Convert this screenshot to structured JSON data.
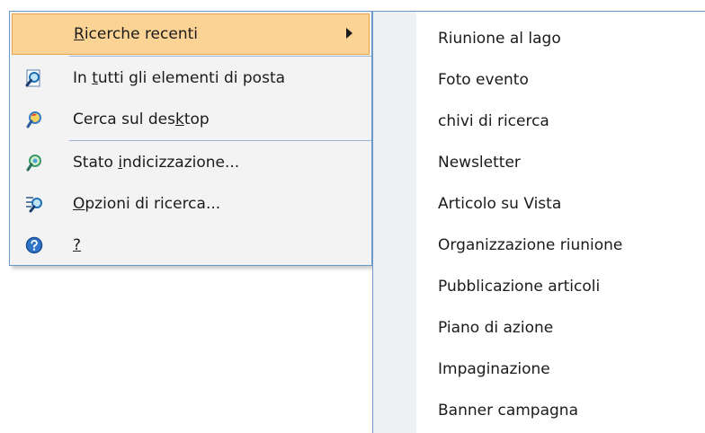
{
  "menu": {
    "items": [
      {
        "before": "",
        "key": "R",
        "after": "icerche recenti",
        "icon": "none",
        "highlighted": true,
        "has_submenu": true
      },
      {
        "before": "In ",
        "key": "t",
        "after": "utti gli elementi di posta",
        "icon": "search-document-icon"
      },
      {
        "before": "Cerca sul des",
        "key": "k",
        "after": "top",
        "icon": "search-desktop-icon"
      },
      {
        "before": "Stato ",
        "key": "i",
        "after": "ndicizzazione...",
        "icon": "indexing-status-icon"
      },
      {
        "before": "",
        "key": "O",
        "after": "pzioni di ricerca...",
        "icon": "search-options-icon"
      },
      {
        "before": "",
        "key": "?",
        "after": "",
        "icon": "help-icon"
      }
    ]
  },
  "submenu": {
    "items": [
      "Riunione al lago",
      "Foto evento",
      "chivi di ricerca",
      "Newsletter",
      "Articolo su Vista",
      "Organizzazione riunione",
      "Pubblicazione articoli",
      "Piano di azione",
      "Impaginazione",
      "Banner campagna"
    ]
  },
  "colors": {
    "highlight_fill": "#fbd394",
    "highlight_border": "#e8a448",
    "menu_border": "#6a98c8",
    "separator": "#9cb8d8"
  }
}
